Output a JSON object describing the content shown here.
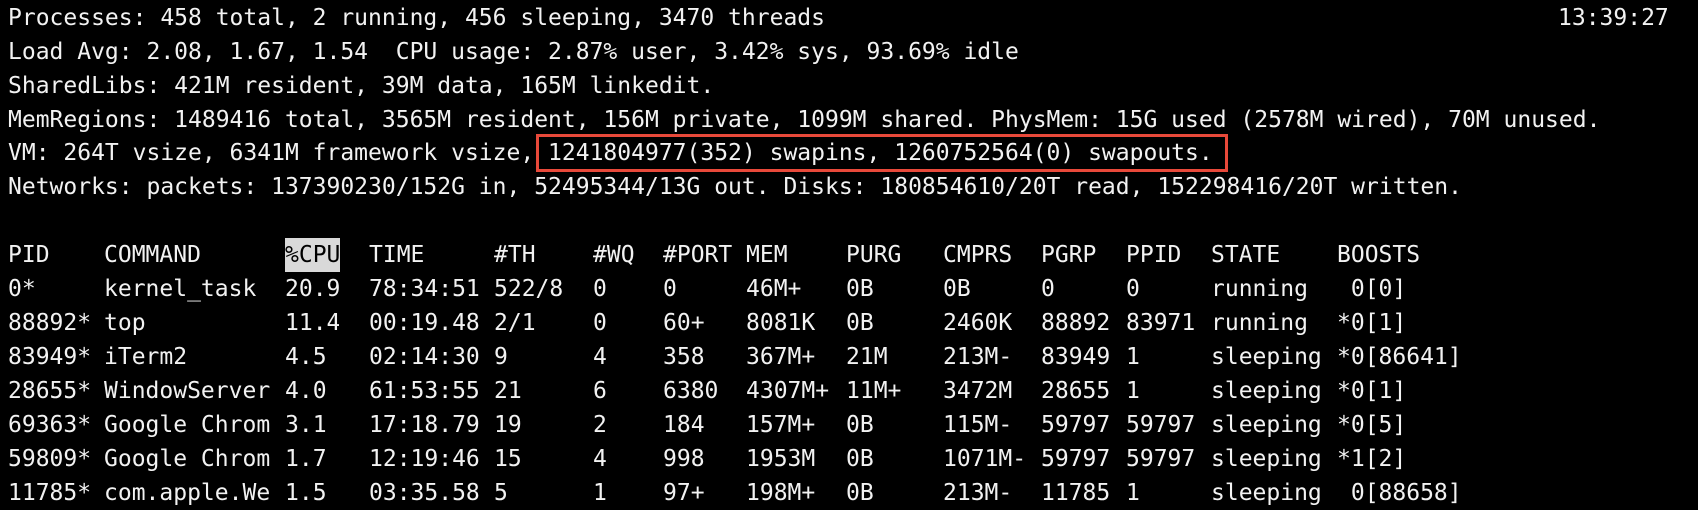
{
  "header": {
    "processes": "Processes: 458 total, 2 running, 456 sleeping, 3470 threads",
    "time": "13:39:27",
    "load": "Load Avg: 2.08, 1.67, 1.54  CPU usage: 2.87% user, 3.42% sys, 93.69% idle",
    "sharedlibs": "SharedLibs: 421M resident, 39M data, 165M linkedit.",
    "memregions": "MemRegions: 1489416 total, 3565M resident, 156M private, 1099M shared. PhysMem: 15G used (2578M wired), 70M unused.",
    "vm": "VM: 264T vsize, 6341M framework vsize, 1241804977(352) swapins, 1260752564(0) swapouts.",
    "networks": "Networks: packets: 137390230/152G in, 52495344/13G out. Disks: 180854610/20T read, 152298416/20T written."
  },
  "highlight": {
    "color": "#e8493a",
    "text": "1241804977(352) swapins, 1260752564(0) swapouts."
  },
  "table": {
    "sorted_column": "%CPU",
    "columns": [
      "PID",
      "COMMAND",
      "%CPU",
      "TIME",
      "#TH",
      "#WQ",
      "#PORT",
      "MEM",
      "PURG",
      "CMPRS",
      "PGRP",
      "PPID",
      "STATE",
      "BOOSTS"
    ],
    "rows": [
      [
        "0*",
        "kernel_task",
        "20.9",
        "78:34:51",
        "522/8",
        "0",
        "0",
        "46M+",
        "0B",
        "0B",
        "0",
        "0",
        "running",
        " 0[0]"
      ],
      [
        "88892*",
        "top",
        "11.4",
        "00:19.48",
        "2/1",
        "0",
        "60+",
        "8081K",
        "0B",
        "2460K",
        "88892",
        "83971",
        "running",
        "*0[1]"
      ],
      [
        "83949*",
        "iTerm2",
        "4.5",
        "02:14:30",
        "9",
        "4",
        "358",
        "367M+",
        "21M",
        "213M-",
        "83949",
        "1",
        "sleeping",
        "*0[86641]"
      ],
      [
        "28655*",
        "WindowServer",
        "4.0",
        "61:53:55",
        "21",
        "6",
        "6380",
        "4307M+",
        "11M+",
        "3472M",
        "28655",
        "1",
        "sleeping",
        "*0[1]"
      ],
      [
        "69363*",
        "Google Chrom",
        "3.1",
        "17:18.79",
        "19",
        "2",
        "184",
        "157M+",
        "0B",
        "115M-",
        "59797",
        "59797",
        "sleeping",
        "*0[5]"
      ],
      [
        "59809*",
        "Google Chrom",
        "1.7",
        "12:19:46",
        "15",
        "4",
        "998",
        "1953M",
        "0B",
        "1071M-",
        "59797",
        "59797",
        "sleeping",
        "*1[2]"
      ],
      [
        "11785*",
        "com.apple.We",
        "1.5",
        "03:35.58",
        "5",
        "1",
        "97+",
        "198M+",
        "0B",
        "213M-",
        "11785",
        "1",
        "sleeping",
        " 0[88658]"
      ]
    ]
  }
}
